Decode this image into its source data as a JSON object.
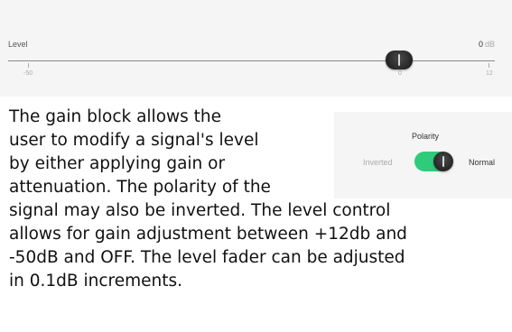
{
  "level": {
    "label": "Level",
    "value": "0",
    "unit": "dB",
    "min_label": "-50",
    "zero_label": "0",
    "max_label": "12",
    "min_db": -50,
    "max_db": 12,
    "current_db": 0
  },
  "polarity": {
    "title": "Polarity",
    "inverted_label": "Inverted",
    "normal_label": "Normal",
    "state": "Normal",
    "accent_color": "#2ecc7a"
  },
  "description": {
    "lines": [
      "The gain block allows the",
      "user to modify a signal's level",
      "by either applying gain or",
      "attenuation. The polarity of the",
      "signal may also be inverted. The level control",
      "allows for gain adjustment between +12db and",
      "-50dB and OFF. The level fader can be adjusted",
      "in 0.1dB increments."
    ]
  },
  "icons": {
    "fader_thumb": "fader-knob-icon",
    "toggle_knob": "toggle-knob-icon"
  }
}
